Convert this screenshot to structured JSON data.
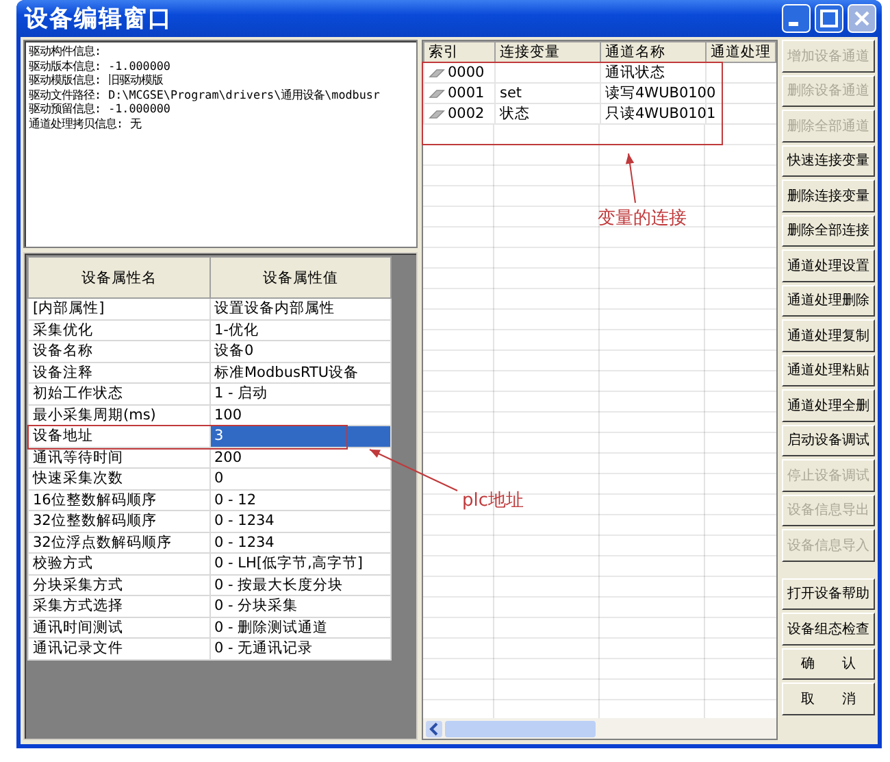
{
  "window": {
    "title": "设备编辑窗口"
  },
  "info_lines": [
    "驱动构件信息:",
    "驱动版本信息: -1.000000",
    "驱动模版信息: 旧驱动模版",
    "驱动文件路径: D:\\MCGSE\\Program\\drivers\\通用设备\\modbusr",
    "驱动预留信息: -1.000000",
    "通道处理拷贝信息: 无"
  ],
  "properties": {
    "columns": [
      "设备属性名",
      "设备属性值"
    ],
    "rows": [
      {
        "name": "[内部属性]",
        "value": "设置设备内部属性",
        "selected": false
      },
      {
        "name": "采集优化",
        "value": "1-优化",
        "selected": false
      },
      {
        "name": "设备名称",
        "value": "设备0",
        "selected": false
      },
      {
        "name": "设备注释",
        "value": "标准ModbusRTU设备",
        "selected": false
      },
      {
        "name": "初始工作状态",
        "value": "1 - 启动",
        "selected": false
      },
      {
        "name": "最小采集周期(ms)",
        "value": "100",
        "selected": false
      },
      {
        "name": "设备地址",
        "value": "3",
        "selected": true
      },
      {
        "name": "通讯等待时间",
        "value": "200",
        "selected": false
      },
      {
        "name": "快速采集次数",
        "value": "0",
        "selected": false
      },
      {
        "name": "16位整数解码顺序",
        "value": "0 - 12",
        "selected": false
      },
      {
        "name": "32位整数解码顺序",
        "value": "0 - 1234",
        "selected": false
      },
      {
        "name": "32位浮点数解码顺序",
        "value": "0 - 1234",
        "selected": false
      },
      {
        "name": "校验方式",
        "value": "0 - LH[低字节,高字节]",
        "selected": false
      },
      {
        "name": "分块采集方式",
        "value": "0 - 按最大长度分块",
        "selected": false
      },
      {
        "name": "采集方式选择",
        "value": "0 - 分块采集",
        "selected": false
      },
      {
        "name": "通讯时间测试",
        "value": "0 - 删除测试通道",
        "selected": false
      },
      {
        "name": "通讯记录文件",
        "value": "0 - 无通讯记录",
        "selected": false
      }
    ]
  },
  "channels": {
    "columns": [
      "索引",
      "连接变量",
      "通道名称",
      "通道处理"
    ],
    "rows": [
      {
        "index": "0000",
        "variable": "",
        "name": "通讯状态"
      },
      {
        "index": "0001",
        "variable": "set",
        "name": "读写4WUB0100"
      },
      {
        "index": "0002",
        "variable": "状态",
        "name": "只读4WUB0101"
      }
    ]
  },
  "buttons": [
    {
      "label": "增加设备通道",
      "disabled": true
    },
    {
      "label": "删除设备通道",
      "disabled": true
    },
    {
      "label": "删除全部通道",
      "disabled": true
    },
    {
      "label": "快速连接变量",
      "disabled": false
    },
    {
      "label": "删除连接变量",
      "disabled": false
    },
    {
      "label": "删除全部连接",
      "disabled": false
    },
    {
      "label": "通道处理设置",
      "disabled": false
    },
    {
      "label": "通道处理删除",
      "disabled": false
    },
    {
      "label": "通道处理复制",
      "disabled": false
    },
    {
      "label": "通道处理粘贴",
      "disabled": false
    },
    {
      "label": "通道处理全删",
      "disabled": false
    },
    {
      "label": "启动设备调试",
      "disabled": false
    },
    {
      "label": "停止设备调试",
      "disabled": true
    },
    {
      "label": "设备信息导出",
      "disabled": true
    },
    {
      "label": "设备信息导入",
      "disabled": true
    },
    {
      "label": "打开设备帮助",
      "disabled": false
    },
    {
      "label": "设备组态检查",
      "disabled": false
    },
    {
      "label": "确　　认",
      "disabled": false
    },
    {
      "label": "取　　消",
      "disabled": false
    }
  ],
  "annotations": [
    {
      "label": "变量的连接"
    },
    {
      "label": "plc地址"
    }
  ]
}
